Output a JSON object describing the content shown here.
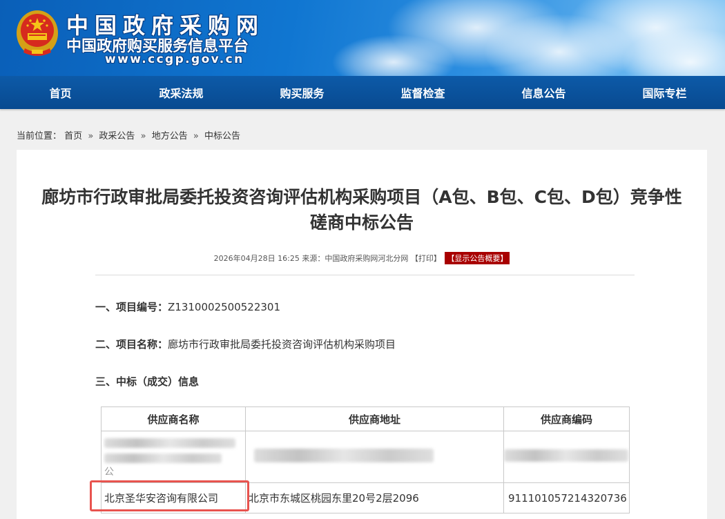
{
  "header": {
    "title": "中国政府采购网",
    "subtitle": "中国政府购买服务信息平台",
    "url": "www.ccgp.gov.cn"
  },
  "nav": {
    "items": [
      {
        "label": "首页"
      },
      {
        "label": "政采法规"
      },
      {
        "label": "购买服务"
      },
      {
        "label": "监督检查"
      },
      {
        "label": "信息公告"
      },
      {
        "label": "国际专栏"
      }
    ]
  },
  "breadcrumb": {
    "prefix": "当前位置：",
    "items": [
      "首页",
      "政采公告",
      "地方公告",
      "中标公告"
    ],
    "separator": "»"
  },
  "article": {
    "title_line1": "廊坊市行政审批局委托投资咨询评估机构采购项目（A包、B包、C包、D包）竞争性",
    "title_line2": "磋商中标公告",
    "meta": {
      "datetime": "2026年04月28日 16:25",
      "source_label": "来源：",
      "source": "中国政府采购网河北分网",
      "print_label": "【打印】",
      "summary_label": "【显示公告概要】"
    },
    "sections": [
      {
        "heading": "一、项目编号：",
        "value": "Z1310002500522301"
      },
      {
        "heading": "二、项目名称：",
        "value": "廊坊市行政审批局委托投资咨询评估机构采购项目"
      },
      {
        "heading": "三、中标（成交）信息",
        "value": ""
      }
    ],
    "table": {
      "headers": [
        "供应商名称",
        "供应商地址",
        "供应商编码"
      ],
      "rows": [
        {
          "name": "",
          "name_tail": "公",
          "address": "",
          "code": "",
          "redacted": true
        },
        {
          "name": "北京圣华安咨询有限公司",
          "address": "北京市东城区桃园东里20号2层2096",
          "code": "911101057214320736",
          "redacted": false
        }
      ]
    }
  },
  "colors": {
    "nav_bg": "#0b52a0",
    "highlight": "#e8534e",
    "summary_bg": "#a80000"
  }
}
